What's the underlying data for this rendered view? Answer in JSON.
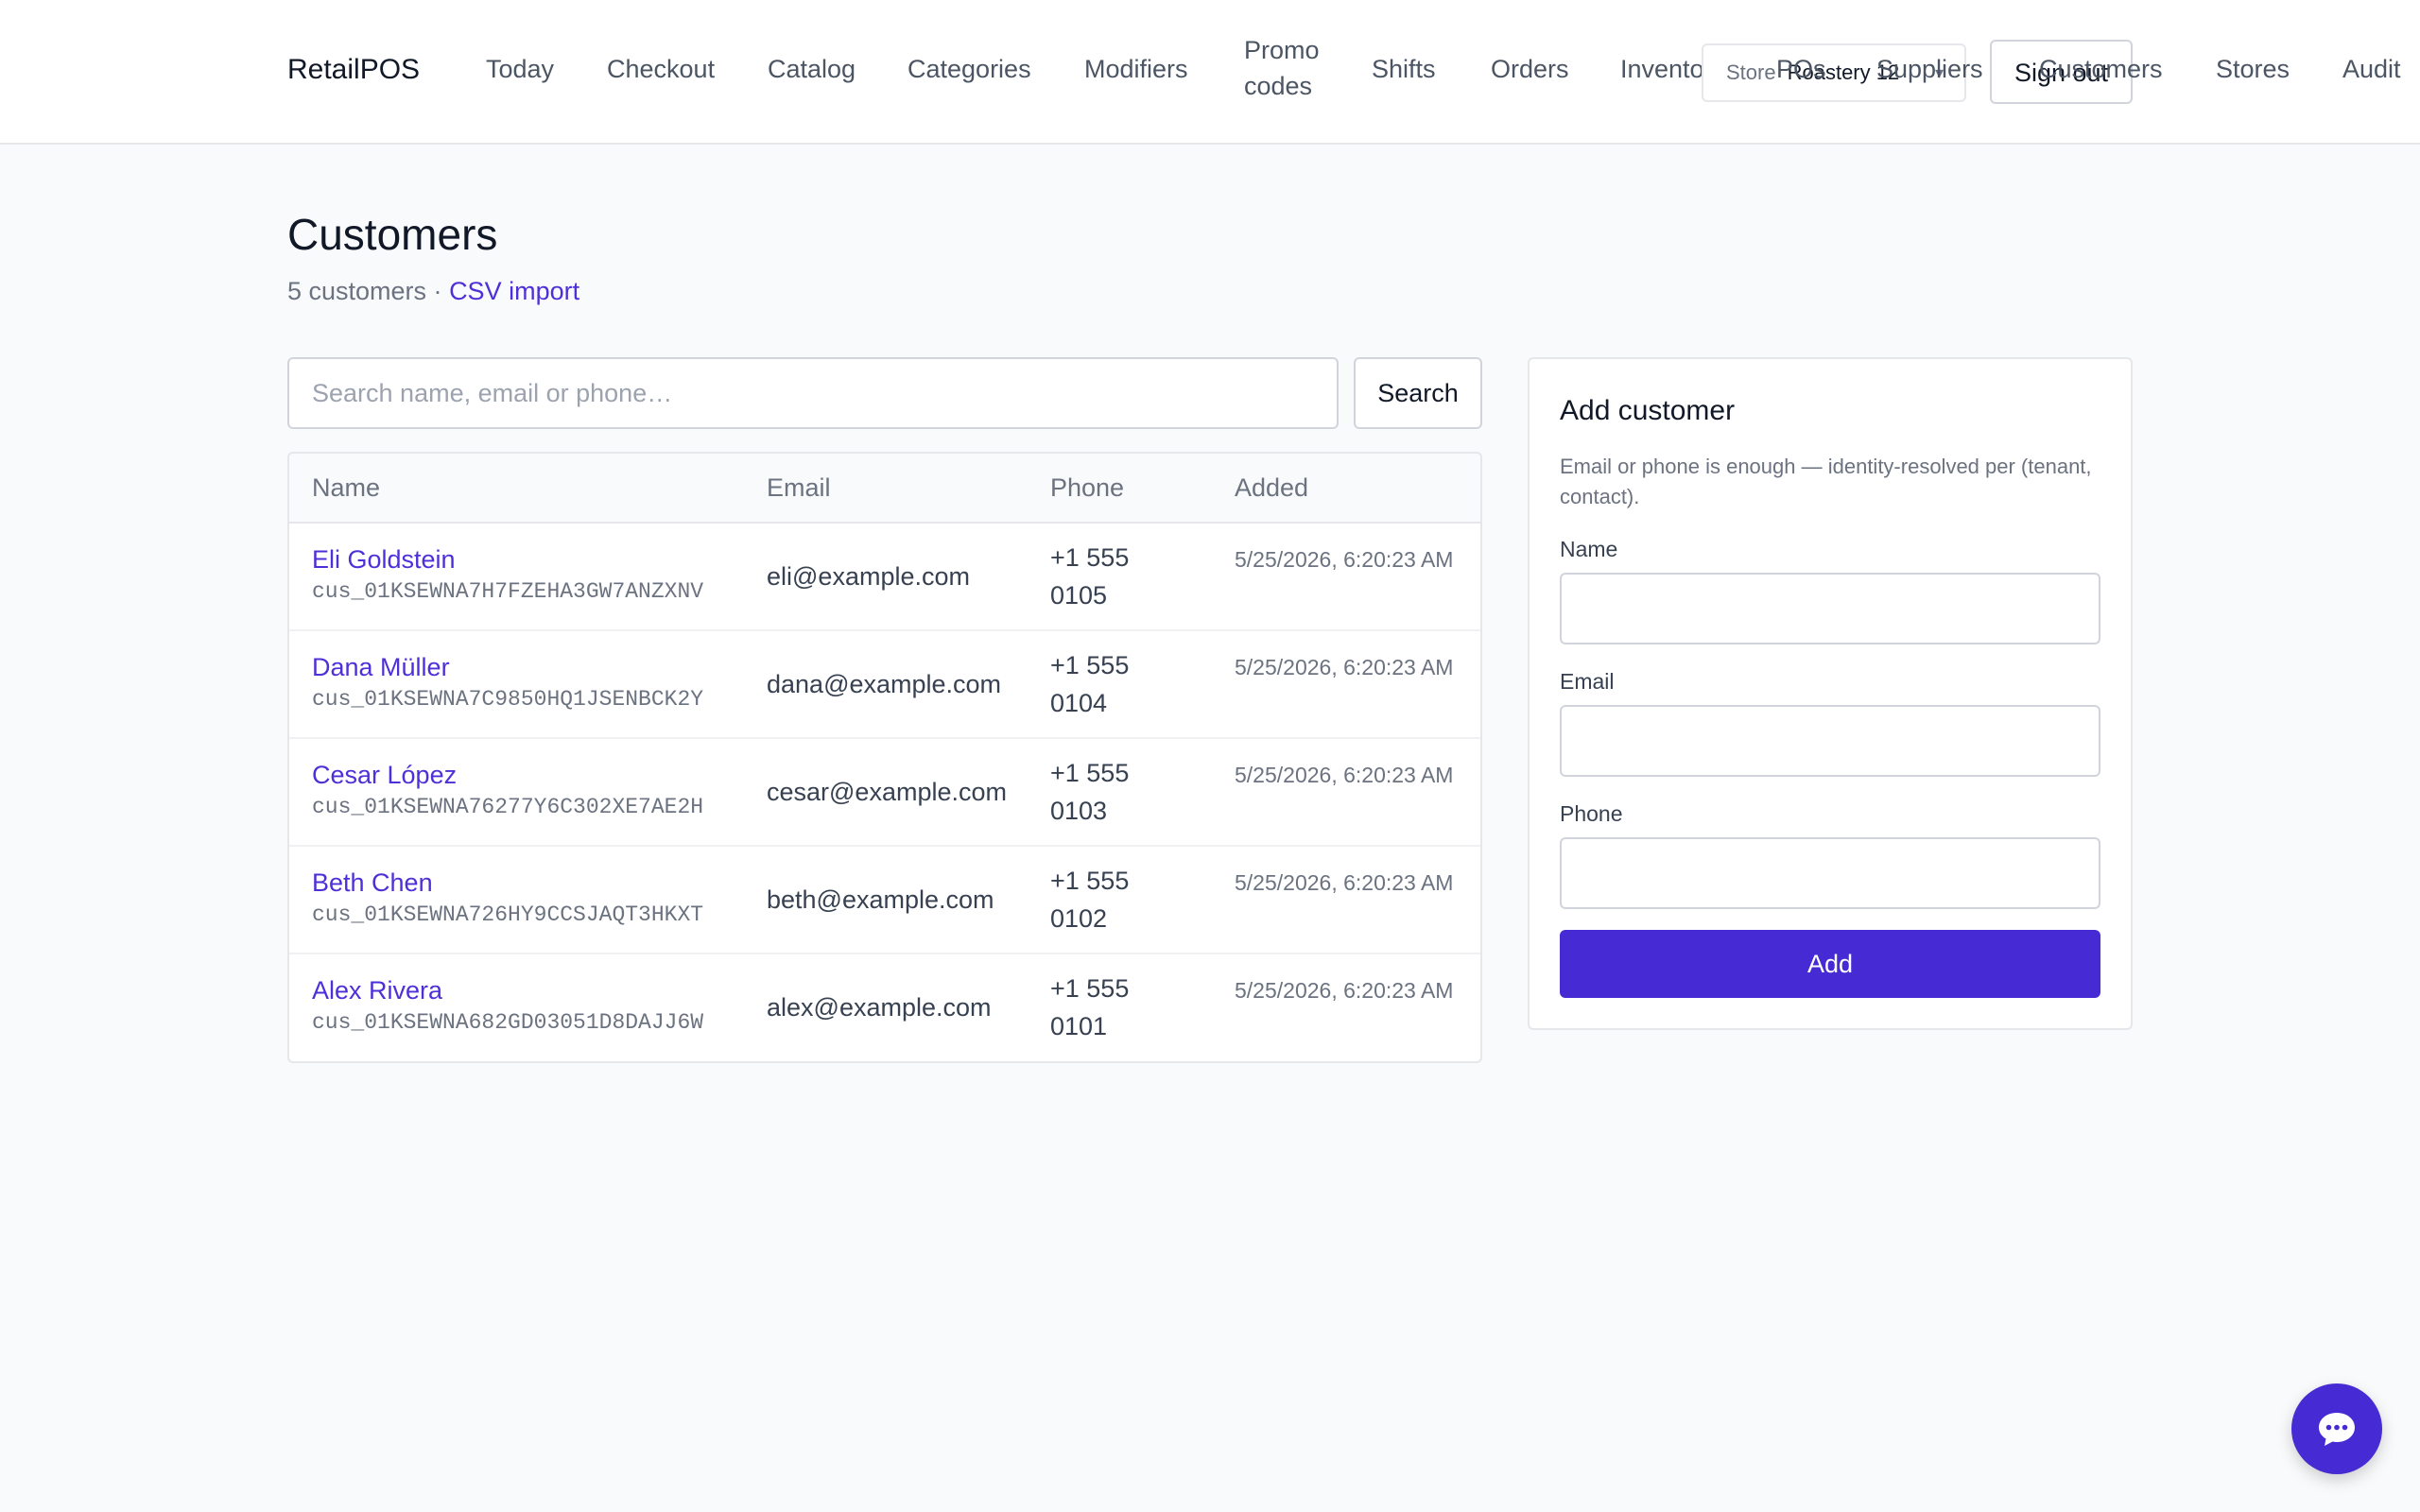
{
  "app": {
    "brand": "RetailPOS"
  },
  "nav": {
    "items": [
      {
        "label": "Today"
      },
      {
        "label": "Checkout"
      },
      {
        "label": "Catalog"
      },
      {
        "label": "Categories"
      },
      {
        "label": "Modifiers"
      },
      {
        "label": "Promo codes"
      },
      {
        "label": "Shifts"
      },
      {
        "label": "Orders"
      },
      {
        "label": "Inventory"
      },
      {
        "label": "POs"
      },
      {
        "label": "Suppliers"
      },
      {
        "label": "Customers"
      },
      {
        "label": "Stores"
      },
      {
        "label": "Audit"
      }
    ]
  },
  "header": {
    "store_label": "Store",
    "store_value": "Roastery 12",
    "signout_label": "Sign out"
  },
  "page": {
    "title": "Customers",
    "count_text": "5 customers ·",
    "csv_link": "CSV import"
  },
  "search": {
    "placeholder": "Search name, email or phone…",
    "value": "",
    "button_label": "Search"
  },
  "table": {
    "headers": {
      "name": "Name",
      "email": "Email",
      "phone": "Phone",
      "added": "Added"
    },
    "rows": [
      {
        "name": "Eli Goldstein",
        "id": "cus_01KSEWNA7H7FZEHA3GW7ANZXNV",
        "email": "eli@example.com",
        "phone": "+1 555 0105",
        "added": "5/25/2026, 6:20:23 AM"
      },
      {
        "name": "Dana Müller",
        "id": "cus_01KSEWNA7C9850HQ1JSENBCK2Y",
        "email": "dana@example.com",
        "phone": "+1 555 0104",
        "added": "5/25/2026, 6:20:23 AM"
      },
      {
        "name": "Cesar López",
        "id": "cus_01KSEWNA76277Y6C302XE7AE2H",
        "email": "cesar@example.com",
        "phone": "+1 555 0103",
        "added": "5/25/2026, 6:20:23 AM"
      },
      {
        "name": "Beth Chen",
        "id": "cus_01KSEWNA726HY9CCSJAQT3HKXT",
        "email": "beth@example.com",
        "phone": "+1 555 0102",
        "added": "5/25/2026, 6:20:23 AM"
      },
      {
        "name": "Alex Rivera",
        "id": "cus_01KSEWNA682GD03051D8DAJJ6W",
        "email": "alex@example.com",
        "phone": "+1 555 0101",
        "added": "5/25/2026, 6:20:23 AM"
      }
    ]
  },
  "add_customer": {
    "title": "Add customer",
    "help": "Email or phone is enough — identity-resolved per (tenant, contact).",
    "name_label": "Name",
    "name_value": "",
    "email_label": "Email",
    "email_value": "",
    "phone_label": "Phone",
    "phone_value": "",
    "button_label": "Add"
  },
  "icons": {
    "chat": "chat-bubble-icon",
    "store_dropdown": "chevron-down-icon"
  },
  "colors": {
    "accent": "#462bd4",
    "link": "#4f2fd8"
  }
}
